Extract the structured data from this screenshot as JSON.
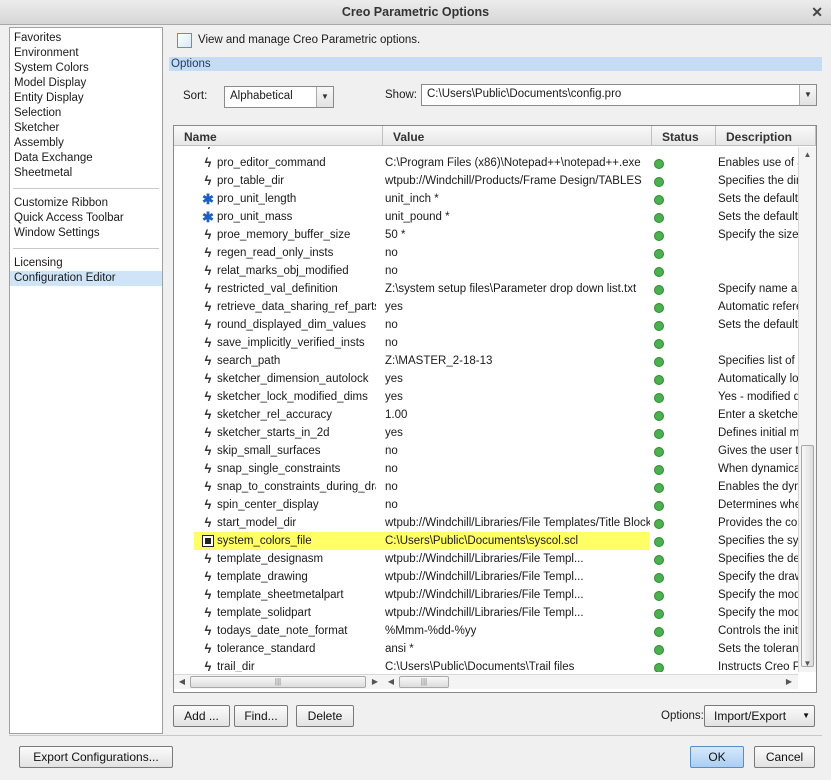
{
  "window": {
    "title": "Creo Parametric Options",
    "close_glyph": "✕"
  },
  "left_nav": {
    "groups": [
      [
        "Favorites",
        "Environment",
        "System Colors",
        "Model Display",
        "Entity Display",
        "Selection",
        "Sketcher",
        "Assembly",
        "Data Exchange",
        "Sheetmetal"
      ],
      [
        "Customize Ribbon",
        "Quick Access Toolbar",
        "Window Settings"
      ],
      [
        "Licensing",
        "Configuration Editor"
      ]
    ],
    "selected": "Configuration Editor"
  },
  "header": {
    "text": "View and manage Creo Parametric options."
  },
  "options_bar": {
    "label": "Options"
  },
  "sort": {
    "label": "Sort:",
    "value": "Alphabetical"
  },
  "show": {
    "label": "Show:",
    "value": "C:\\Users\\Public\\Documents\\config.pro"
  },
  "table": {
    "columns": [
      "Name",
      "Value",
      "Status",
      "Description"
    ],
    "rows": [
      {
        "icon": "bolt",
        "name": "pro_editor_command",
        "value": "C:\\Program Files (x86)\\Notepad++\\notepad++.exe",
        "desc": "Enables use of a"
      },
      {
        "icon": "bolt",
        "name": "pro_table_dir",
        "value": "wtpub://Windchill/Products/Frame Design/TABLES",
        "desc": "Specifies the dire"
      },
      {
        "icon": "star",
        "name": "pro_unit_length",
        "value": "unit_inch *",
        "desc": "Sets the default"
      },
      {
        "icon": "star",
        "name": "pro_unit_mass",
        "value": "unit_pound *",
        "desc": "Sets the default"
      },
      {
        "icon": "bolt",
        "name": "proe_memory_buffer_size",
        "value": "50 *",
        "desc": "Specify the size"
      },
      {
        "icon": "bolt",
        "name": "regen_read_only_insts",
        "value": "no",
        "desc": ""
      },
      {
        "icon": "bolt",
        "name": "relat_marks_obj_modified",
        "value": "no",
        "desc": ""
      },
      {
        "icon": "bolt",
        "name": "restricted_val_definition",
        "value": "Z:\\system setup files\\Parameter drop down list.txt",
        "desc": "Specify name an"
      },
      {
        "icon": "bolt",
        "name": "retrieve_data_sharing_ref_parts",
        "value": "yes",
        "desc": "Automatic refere"
      },
      {
        "icon": "bolt",
        "name": "round_displayed_dim_values",
        "value": "no",
        "desc": "Sets the default"
      },
      {
        "icon": "bolt",
        "name": "save_implicitly_verified_insts",
        "value": "no",
        "desc": ""
      },
      {
        "icon": "bolt",
        "name": "search_path",
        "value": "Z:\\MASTER_2-18-13",
        "desc": "Specifies list of c"
      },
      {
        "icon": "bolt",
        "name": "sketcher_dimension_autolock",
        "value": "yes",
        "desc": "Automatically loc"
      },
      {
        "icon": "bolt",
        "name": "sketcher_lock_modified_dims",
        "value": "yes",
        "desc": "Yes - modified di"
      },
      {
        "icon": "bolt",
        "name": "sketcher_rel_accuracy",
        "value": "1.00",
        "desc": "Enter a sketcher"
      },
      {
        "icon": "bolt",
        "name": "sketcher_starts_in_2d",
        "value": "yes",
        "desc": "Defines initial mo"
      },
      {
        "icon": "bolt",
        "name": "skip_small_surfaces",
        "value": "no",
        "desc": "Gives the user th"
      },
      {
        "icon": "bolt",
        "name": "snap_single_constraints",
        "value": "no",
        "desc": "When dynamica"
      },
      {
        "icon": "bolt",
        "name": "snap_to_constraints_during_drag",
        "value": "no",
        "desc": "Enables the dyna"
      },
      {
        "icon": "bolt",
        "name": "spin_center_display",
        "value": "no",
        "desc": "Determines whet"
      },
      {
        "icon": "bolt",
        "name": "start_model_dir",
        "value": "wtpub://Windchill/Libraries/File Templates/Title Blocks",
        "desc": "Provides the con"
      },
      {
        "icon": "select",
        "name": "system_colors_file",
        "value": "C:\\Users\\Public\\Documents\\syscol.scl",
        "desc": "Specifies the sys",
        "highlight": true
      },
      {
        "icon": "bolt",
        "name": "template_designasm",
        "value": "wtpub://Windchill/Libraries/File Templ...",
        "desc": "Specifies the des"
      },
      {
        "icon": "bolt",
        "name": "template_drawing",
        "value": "wtpub://Windchill/Libraries/File Templ...",
        "desc": "Specify the draw"
      },
      {
        "icon": "bolt",
        "name": "template_sheetmetalpart",
        "value": "wtpub://Windchill/Libraries/File Templ...",
        "desc": "Specify the mode"
      },
      {
        "icon": "bolt",
        "name": "template_solidpart",
        "value": "wtpub://Windchill/Libraries/File Templ...",
        "desc": "Specify the mode"
      },
      {
        "icon": "bolt",
        "name": "todays_date_note_format",
        "value": "%Mmm-%dd-%yy",
        "desc": "Controls the initia"
      },
      {
        "icon": "bolt",
        "name": "tolerance_standard",
        "value": "ansi *",
        "desc": "Sets the toleranc"
      },
      {
        "icon": "bolt",
        "name": "trail_dir",
        "value": "C:\\Users\\Public\\Documents\\Trail files",
        "desc": "Instructs Creo Pa"
      }
    ]
  },
  "buttons": {
    "add": "Add ...",
    "find": "Find...",
    "delete": "Delete",
    "options_label": "Options:",
    "import_export": "Import/Export",
    "export_configs": "Export Configurations...",
    "ok": "OK",
    "cancel": "Cancel"
  },
  "colors": {
    "selection": "#cfe4f7",
    "highlight": "#ffff66",
    "status_ok": "#4caf50",
    "options_bar": "#c6dcf4"
  }
}
